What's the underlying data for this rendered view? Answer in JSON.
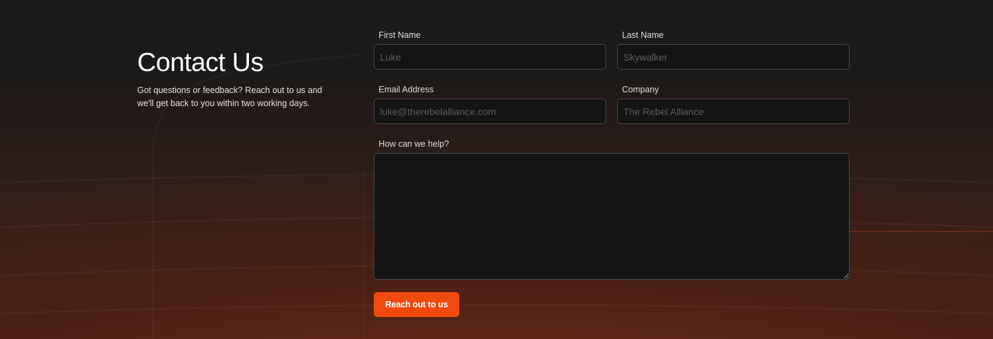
{
  "header": {
    "title": "Contact Us",
    "description": "Got questions or feedback? Reach out to us and we'll get back to you within two working days."
  },
  "form": {
    "first_name": {
      "label": "First Name",
      "placeholder": "Luke"
    },
    "last_name": {
      "label": "Last Name",
      "placeholder": "Skywalker"
    },
    "email": {
      "label": "Email Address",
      "placeholder": "luke@therebelalliance.com"
    },
    "company": {
      "label": "Company",
      "placeholder": "The Rebel Alliance"
    },
    "message": {
      "label": "How can we help?",
      "placeholder": ""
    },
    "submit_label": "Reach out to us"
  },
  "colors": {
    "accent": "#f04a0f",
    "background": "#1b1a1a",
    "input_background": "#151414",
    "input_border": "#4a4746"
  }
}
